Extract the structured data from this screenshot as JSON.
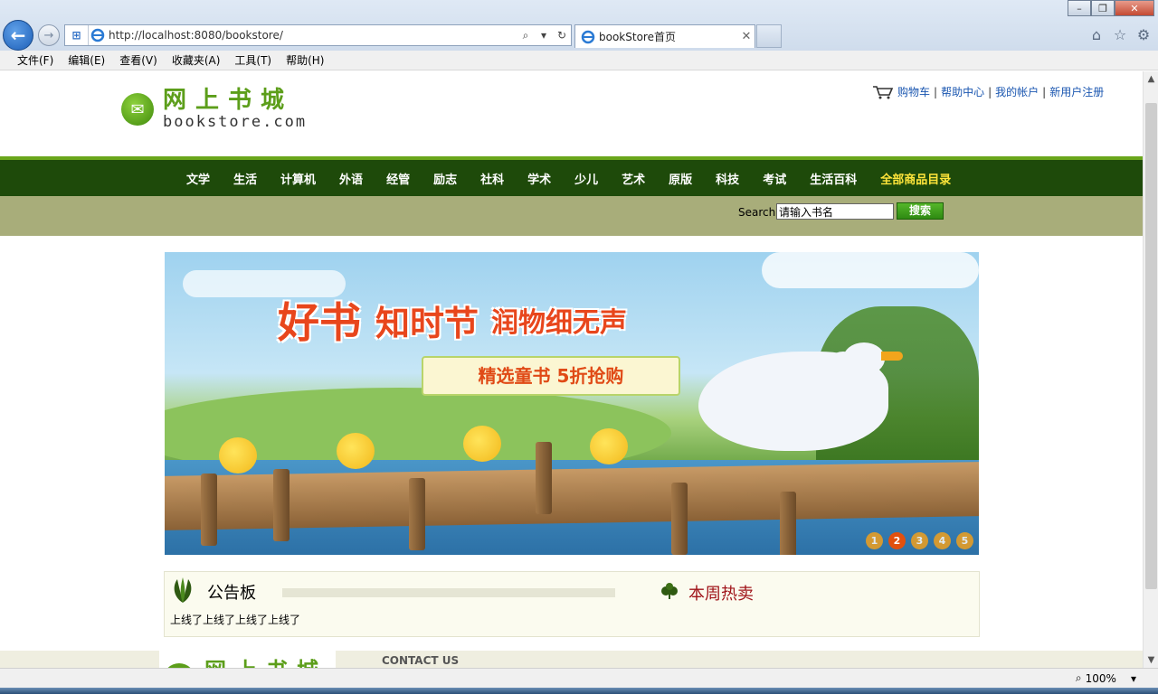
{
  "browser": {
    "url": "http://localhost:8080/bookstore/",
    "tab_title": "bookStore首页",
    "menus": [
      "文件(F)",
      "编辑(E)",
      "查看(V)",
      "收藏夹(A)",
      "工具(T)",
      "帮助(H)"
    ],
    "zoom": "100%"
  },
  "header": {
    "logo_cn": "网上书城",
    "logo_en": "bookstore.com",
    "links": [
      "购物车",
      "帮助中心",
      "我的帐户",
      "新用户注册"
    ]
  },
  "nav": {
    "items": [
      "文学",
      "生活",
      "计算机",
      "外语",
      "经管",
      "励志",
      "社科",
      "学术",
      "少儿",
      "艺术",
      "原版",
      "科技",
      "考试",
      "生活百科"
    ],
    "highlight": "全部商品目录"
  },
  "search": {
    "label": "Search",
    "value": "请输入书名",
    "button": "搜索"
  },
  "banner": {
    "title1": "好书",
    "title2": "知时节",
    "title3": "润物细无声",
    "ribbon": "精选童书 5折抢购",
    "dots": [
      "1",
      "2",
      "3",
      "4",
      "5"
    ],
    "active_dot": 2
  },
  "board": {
    "title": "公告板",
    "text": "上线了上线了上线了上线了",
    "hot_title": "本周热卖"
  },
  "footer": {
    "logo_cn": "网上书城",
    "contact": "CONTACT US"
  },
  "side_float": "49",
  "colors": {
    "nav_bg": "#1e4a0a",
    "nav_line": "#6aa61c",
    "search_bg": "#a8ad7a",
    "link": "#1a56b0",
    "highlight": "#ffe53a",
    "hot": "#a0141a"
  }
}
